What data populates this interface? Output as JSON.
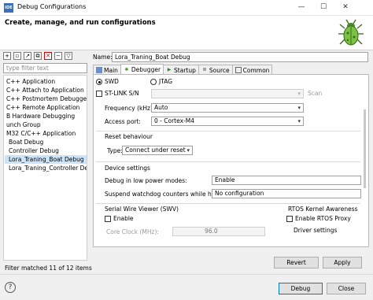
{
  "window": {
    "title": "Debug Configurations",
    "app_icon": "IDE",
    "minimize": "—",
    "maximize": "☐",
    "close": "✕"
  },
  "header": {
    "title": "Create, manage, and run configurations"
  },
  "sidebar": {
    "filter_placeholder": "type filter text",
    "items": [
      "C++ Application",
      "C++ Attach to Application",
      "C++ Postmortem Debugger",
      "C++ Remote Application",
      "B Hardware Debugging",
      "unch Group",
      "M32 C/C++ Application",
      "Boat Debug",
      "Controller Debug",
      "Lora_Traning_Boat Debug",
      "Lora_Traning_Controller Debug"
    ],
    "selected_index": 9,
    "status": "Filter matched 11 of 12 items"
  },
  "config": {
    "name_label": "Name:",
    "name_value": "Lora_Traning_Boat Debug",
    "tabs": [
      "Main",
      "Debugger",
      "Startup",
      "Source",
      "Common"
    ],
    "active_tab": "Debugger",
    "swd": "SWD",
    "jtag": "JTAG",
    "stlink": "ST-LINK S/N",
    "scan": "Scan",
    "frequency_label": "Frequency (kHz):",
    "frequency_value": "Auto",
    "access_port_label": "Access port:",
    "access_port_value": "0 - Cortex-M4",
    "reset_behaviour": "Reset behaviour",
    "type_label": "Type:",
    "type_value": "Connect under reset",
    "device_settings": "Device settings",
    "low_power_label": "Debug in low power modes:",
    "low_power_value": "Enable",
    "watchdog_label": "Suspend watchdog counters while halted:",
    "watchdog_value": "No configuration",
    "swv_title": "Serial Wire Viewer (SWV)",
    "swv_enable": "Enable",
    "core_clock_label": "Core Clock (MHz):",
    "core_clock_value": "96.0",
    "rtos_title": "RTOS Kernel Awareness",
    "rtos_enable": "Enable RTOS Proxy",
    "driver_settings": "Driver settings"
  },
  "buttons": {
    "revert": "Revert",
    "apply": "Apply",
    "debug": "Debug",
    "close": "Close"
  }
}
